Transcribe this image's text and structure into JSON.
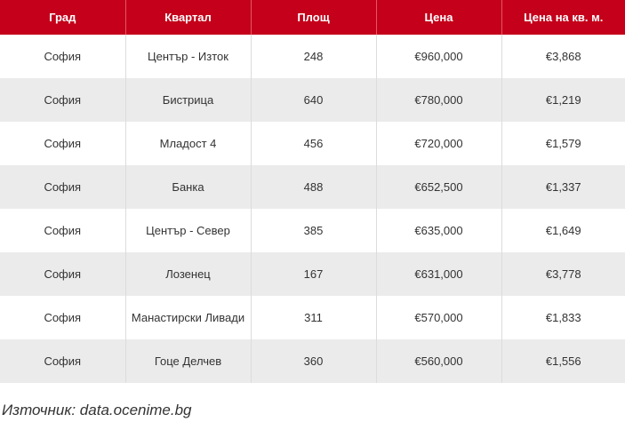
{
  "table": {
    "headers": [
      "Град",
      "Квартал",
      "Площ",
      "Цена",
      "Цена на кв. м."
    ],
    "rows": [
      [
        "София",
        "Център - Изток",
        "248",
        "€960,000",
        "€3,868"
      ],
      [
        "София",
        "Бистрица",
        "640",
        "€780,000",
        "€1,219"
      ],
      [
        "София",
        "Младост 4",
        "456",
        "€720,000",
        "€1,579"
      ],
      [
        "София",
        "Банка",
        "488",
        "€652,500",
        "€1,337"
      ],
      [
        "София",
        "Център - Север",
        "385",
        "€635,000",
        "€1,649"
      ],
      [
        "София",
        "Лозенец",
        "167",
        "€631,000",
        "€3,778"
      ],
      [
        "София",
        "Манастирски Ливади",
        "311",
        "€570,000",
        "€1,833"
      ],
      [
        "София",
        "Гоце Делчев",
        "360",
        "€560,000",
        "€1,556"
      ]
    ]
  },
  "source": {
    "text": "Източник: data.ocenime.bg"
  },
  "colors": {
    "header_bg": "#c4001a",
    "row_alt_bg": "#ebebeb"
  }
}
